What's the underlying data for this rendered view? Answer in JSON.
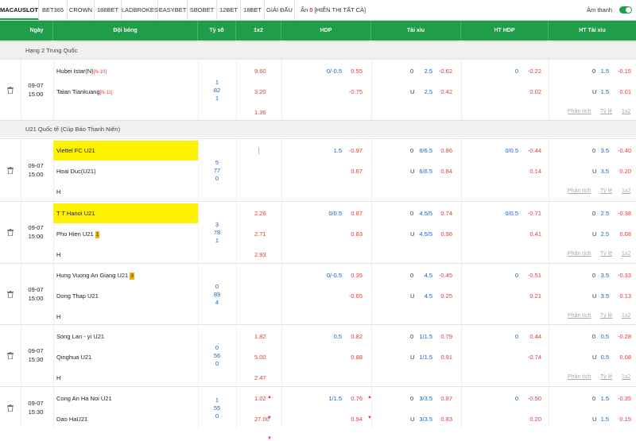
{
  "tabs": [
    "MACAUSLOT",
    "BET365",
    "CROWN",
    "188BET",
    "LADBROKES",
    "EASYBET",
    "SBOBET",
    "12BET",
    "18BET",
    "GIẢI ĐẤU"
  ],
  "hide": {
    "label": "Ẩn",
    "count": "0",
    "show_all": "[HIỂN THỊ TẤT CẢ]"
  },
  "sound": "Âm thanh",
  "columns": {
    "date": "Ngày",
    "teams": "Đội bóng",
    "score": "Tỷ số",
    "x12": "1x2",
    "hdp": "HDP",
    "ou": "Tài xỉu",
    "ht_hdp": "HT HDP",
    "ht_ou": "HT Tài xỉu"
  },
  "links": {
    "analysis": "Phân tích",
    "rate": "Tỷ lệ",
    "x12": "1x2"
  },
  "leagues": [
    {
      "name": "Hạng 2 Trung Quốc",
      "matches": [
        {
          "date": "09-07",
          "time": "15:00",
          "home": "Hubei Istar(N)",
          "home_rank": "[N-10]",
          "away": "Taian Tiankuang",
          "away_rank": "[N-11]",
          "score": [
            "1",
            "82",
            "1"
          ],
          "x12": [
            "9.60",
            "3.20",
            "1.36"
          ],
          "hdp": {
            "line": "0/-0.5",
            "h": "0.55",
            "a": "-0.75"
          },
          "ou": {
            "o_line": "2.5",
            "o": "-0.62",
            "u_line": "2.5",
            "u": "0.42"
          },
          "ht_hdp": {
            "line": "0",
            "h": "-0.22",
            "a": "0.02"
          },
          "ht_ou": {
            "o_line": "1.5",
            "o": "-0.15",
            "u_line": "1.5",
            "u": "0.01"
          }
        }
      ]
    },
    {
      "name": "U21 Quốc tế (Cúp Báo Thanh Niên)",
      "matches": [
        {
          "date": "09-07",
          "time": "15:00",
          "home": "Viettel FC U21",
          "away": "Hoai Duc(U21)",
          "draw": "H",
          "score": [
            "5",
            "77",
            "0"
          ],
          "x12": [
            "",
            "",
            ""
          ],
          "hdp": {
            "line": "1.5",
            "h": "-0.97",
            "a": "0.67"
          },
          "ou": {
            "o_line": "6/6.5",
            "o": "0.86",
            "u_line": "6/6.5",
            "u": "0.84"
          },
          "ht_hdp": {
            "line": "0/0.5",
            "h": "-0.44",
            "a": "0.14"
          },
          "ht_ou": {
            "o_line": "3.5",
            "o": "-0.40",
            "u_line": "3.5",
            "u": "0.20"
          }
        },
        {
          "date": "09-07",
          "time": "15:00",
          "home": "T T Hanoi U21",
          "away": "Pho Hien U21",
          "away_card": "1",
          "draw": "H",
          "score": [
            "3",
            "78",
            "1"
          ],
          "x12": [
            "2.26",
            "2.71",
            "2.93"
          ],
          "hdp": {
            "line": "0/0.5",
            "h": "0.87",
            "a": "0.83"
          },
          "ou": {
            "o_line": "4.5/5",
            "o": "0.74",
            "u_line": "4.5/5",
            "u": "0.96"
          },
          "ht_hdp": {
            "line": "0/0.5",
            "h": "-0.71",
            "a": "0.41"
          },
          "ht_ou": {
            "o_line": "2.5",
            "o": "-0.38",
            "u_line": "2.5",
            "u": "0.08"
          }
        },
        {
          "date": "09-07",
          "time": "15:00",
          "home": "Hung Vuong An Giang U21",
          "home_card": "3",
          "away": "Dong Thap U21",
          "draw": "H",
          "score": [
            "0",
            "89",
            "4"
          ],
          "x12": [
            "",
            "",
            ""
          ],
          "hdp": {
            "line": "0/-0.5",
            "h": "0.35",
            "a": "-0.65"
          },
          "ou": {
            "o_line": "4.5",
            "o": "-0.45",
            "u_line": "4.5",
            "u": "0.25"
          },
          "ht_hdp": {
            "line": "0",
            "h": "-0.51",
            "a": "0.21"
          },
          "ht_ou": {
            "o_line": "3.5",
            "o": "-0.33",
            "u_line": "3.5",
            "u": "0.13"
          }
        },
        {
          "date": "09-07",
          "time": "15:30",
          "home": "Song Lan - yi U21",
          "away": "Qinghua U21",
          "draw": "H",
          "score": [
            "0",
            "56",
            "0"
          ],
          "x12": [
            "1.82",
            "5.00",
            "2.47"
          ],
          "hdp": {
            "line": "0.5",
            "h": "0.82",
            "a": "0.88"
          },
          "ou": {
            "o_line": "1/1.5",
            "o": "0.79",
            "u_line": "1/1.5",
            "u": "0.91"
          },
          "ht_hdp": {
            "line": "0",
            "h": "0.44",
            "a": "-0.74"
          },
          "ht_ou": {
            "o_line": "0.5",
            "o": "-0.28",
            "u_line": "0.5",
            "u": "0.08"
          }
        },
        {
          "date": "09-07",
          "time": "15:30",
          "home": "Cong An Ha Noi U21",
          "away": "Dao HaU21",
          "score": [
            "1",
            "55",
            "0"
          ],
          "x12": [
            "1.02",
            "27.00",
            ""
          ],
          "hdp": {
            "line": "1/1.5",
            "h": "0.76",
            "a": "0.94"
          },
          "ou": {
            "o_line": "3/3.5",
            "o": "0.87",
            "u_line": "3/3.5",
            "u": "0.83"
          },
          "ht_hdp": {
            "line": "0",
            "h": "-0.50",
            "a": "0.20"
          },
          "ht_ou": {
            "o_line": "1.5",
            "o": "-0.35",
            "u_line": "1.5",
            "u": "0.15"
          }
        }
      ]
    }
  ],
  "ou_labels": {
    "over": "0",
    "under": "U"
  },
  "colors": {
    "header_green": "#1f9d49",
    "highlight_yellow": "#fff200",
    "odd_red": "#e53935",
    "odd_blue": "#1565c0"
  }
}
